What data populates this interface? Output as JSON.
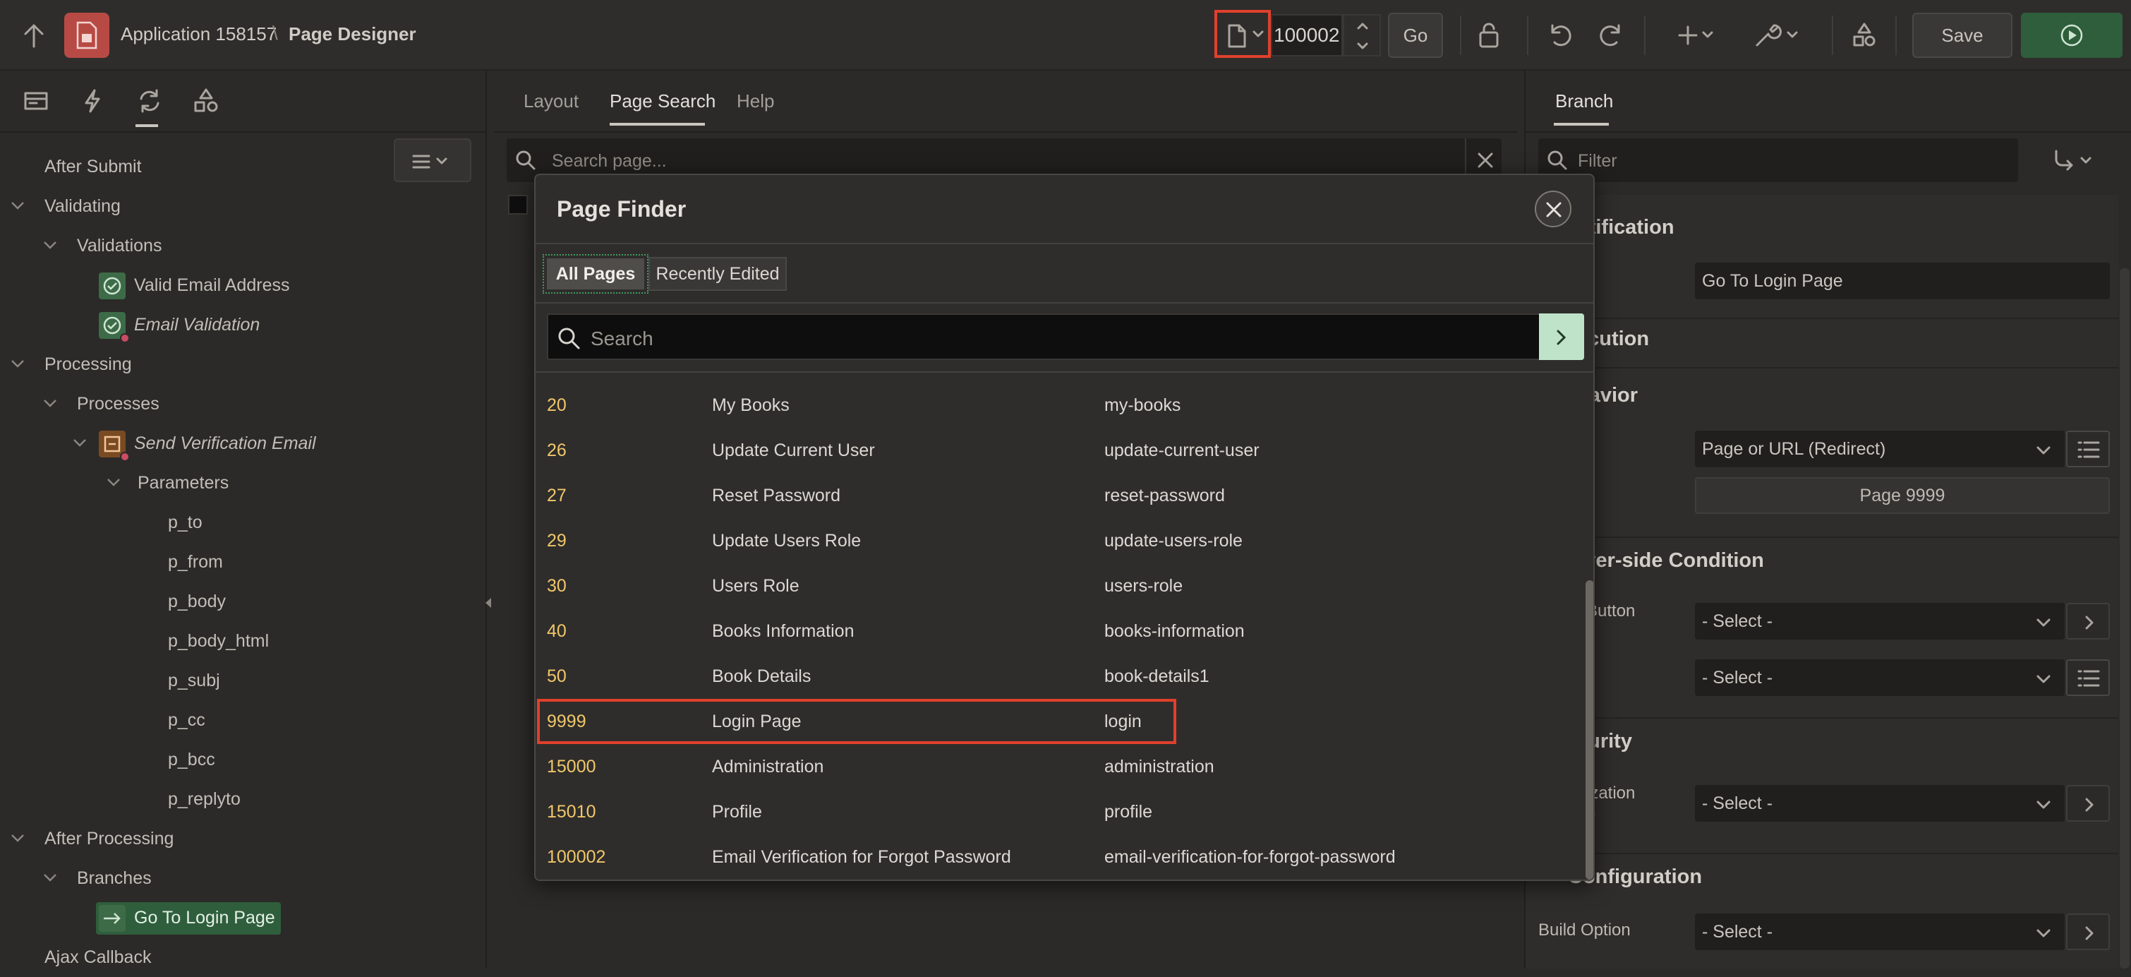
{
  "topbar": {
    "breadcrumb_app": "Application 158157",
    "breadcrumb_sep": "\\",
    "breadcrumb_page": "Page Designer",
    "page_number": "100002",
    "go_label": "Go",
    "save_label": "Save",
    "icons": [
      "up-arrow-icon",
      "app-icon",
      "page-icon",
      "chevron-down-icon",
      "spinner-up-icon",
      "spinner-down-icon",
      "lock-icon",
      "undo-icon",
      "redo-icon",
      "plus-icon",
      "wrench-icon",
      "shapes-icon",
      "run-icon"
    ],
    "colors": {
      "save_bg": "#3a3836",
      "run_bg": "#2f5e3c",
      "app_icon_bg": "#b84a45",
      "highlight": "#e0402c"
    }
  },
  "left_panel": {
    "tab_icons": [
      "rendering-icon",
      "dynamic-actions-icon",
      "processing-icon",
      "shared-components-icon"
    ],
    "menu_icon": "menu-icon",
    "tree": [
      {
        "label": "After Submit",
        "level": 0
      },
      {
        "label": "Validating",
        "level": 0,
        "caret": true
      },
      {
        "label": "Validations",
        "level": 1,
        "caret": true
      },
      {
        "label": "Valid Email Address",
        "level": 2,
        "icon": "validation-icon"
      },
      {
        "label": "Email Validation",
        "level": 2,
        "icon": "validation-icon",
        "italic": true
      },
      {
        "label": "Processing",
        "level": 0,
        "caret": true
      },
      {
        "label": "Processes",
        "level": 1,
        "caret": true
      },
      {
        "label": "Send Verification Email",
        "level": 2,
        "icon": "process-icon",
        "italic": true,
        "caret": true
      },
      {
        "label": "Parameters",
        "level": 3,
        "caret": true
      },
      {
        "label": "p_to",
        "level": 4
      },
      {
        "label": "p_from",
        "level": 4
      },
      {
        "label": "p_body",
        "level": 4
      },
      {
        "label": "p_body_html",
        "level": 4
      },
      {
        "label": "p_subj",
        "level": 4
      },
      {
        "label": "p_cc",
        "level": 4
      },
      {
        "label": "p_bcc",
        "level": 4
      },
      {
        "label": "p_replyto",
        "level": 4
      },
      {
        "label": "After Processing",
        "level": 0,
        "caret": true
      },
      {
        "label": "Branches",
        "level": 1,
        "caret": true
      },
      {
        "label": "Go To Login Page",
        "level": 2,
        "icon": "branch-icon",
        "selected": true
      },
      {
        "label": "Ajax Callback",
        "level": 0
      }
    ]
  },
  "center": {
    "tabs": [
      "Layout",
      "Page Search",
      "Help"
    ],
    "active_tab": "Page Search",
    "search_placeholder": "Search page..."
  },
  "dialog": {
    "title": "Page Finder",
    "filters": [
      "All Pages",
      "Recently Edited"
    ],
    "active_filter": "All Pages",
    "search_placeholder": "Search",
    "rows": [
      {
        "num": "20",
        "name": "My Books",
        "alias": "my-books"
      },
      {
        "num": "26",
        "name": "Update Current User",
        "alias": "update-current-user"
      },
      {
        "num": "27",
        "name": "Reset Password",
        "alias": "reset-password"
      },
      {
        "num": "29",
        "name": "Update Users Role",
        "alias": "update-users-role"
      },
      {
        "num": "30",
        "name": "Users Role",
        "alias": "users-role"
      },
      {
        "num": "40",
        "name": "Books Information",
        "alias": "books-information"
      },
      {
        "num": "50",
        "name": "Book Details",
        "alias": "book-details1"
      },
      {
        "num": "9999",
        "name": "Login Page",
        "alias": "login",
        "highlighted": true
      },
      {
        "num": "15000",
        "name": "Administration",
        "alias": "administration"
      },
      {
        "num": "15010",
        "name": "Profile",
        "alias": "profile"
      },
      {
        "num": "100002",
        "name": "Email Verification for Forgot Password",
        "alias": "email-verification-for-forgot-password"
      }
    ]
  },
  "right_panel": {
    "tab": "Branch",
    "filter_placeholder": "Filter",
    "sections": {
      "identification": "ntification",
      "execution": "ecution",
      "behavior": "havior",
      "server_side": "rver-side Condition",
      "security": "curity",
      "configuration": "Configuration"
    },
    "name_value": "Go To Login Page",
    "type_value": "Page or URL (Redirect)",
    "target_value": "Page 9999",
    "button_label_partial": "Button",
    "select_value": "- Select -",
    "auth_label_partial": "ization",
    "auth_label_partial2": "e",
    "build_option_label": "Build Option"
  }
}
